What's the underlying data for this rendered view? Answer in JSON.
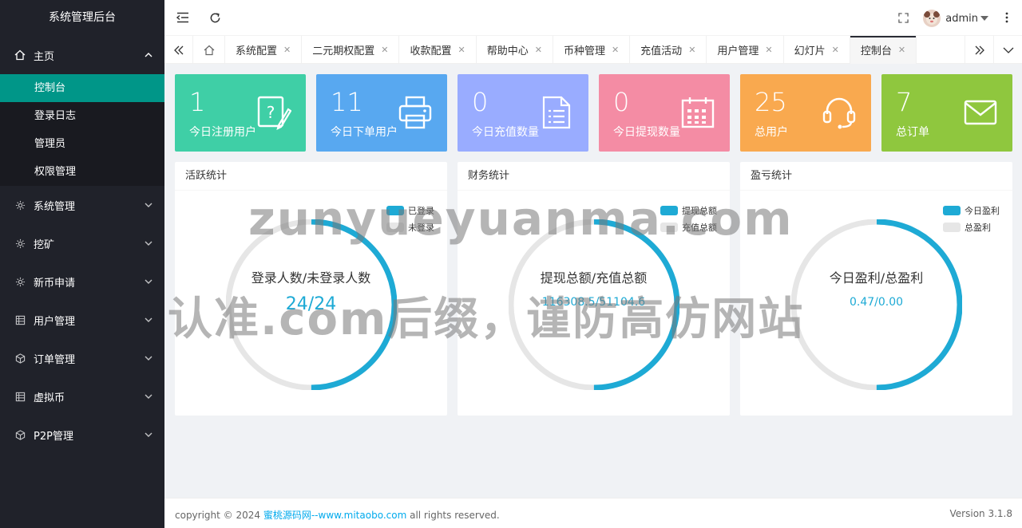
{
  "sidebar": {
    "title": "系统管理后台",
    "home": {
      "label": "主页",
      "icon": "home-icon"
    },
    "home_items": [
      {
        "label": "控制台",
        "active": true
      },
      {
        "label": "登录日志"
      },
      {
        "label": "管理员"
      },
      {
        "label": "权限管理"
      }
    ],
    "groups": [
      {
        "label": "系统管理",
        "icon": "gear-icon"
      },
      {
        "label": "挖矿",
        "icon": "gear-icon"
      },
      {
        "label": "新币申请",
        "icon": "gear-icon"
      },
      {
        "label": "用户管理",
        "icon": "table-icon"
      },
      {
        "label": "订单管理",
        "icon": "cube-icon"
      },
      {
        "label": "虚拟币",
        "icon": "table-icon"
      },
      {
        "label": "P2P管理",
        "icon": "cube-icon"
      }
    ]
  },
  "header": {
    "user": "admin"
  },
  "tabs": {
    "items": [
      "系统配置",
      "二元期权配置",
      "收款配置",
      "帮助中心",
      "币种管理",
      "充值活动",
      "用户管理",
      "幻灯片",
      "控制台"
    ],
    "active": "控制台"
  },
  "cards": [
    {
      "value": "1",
      "label": "今日注册用户",
      "color": "#3fcfa6",
      "icon": "question-note-icon"
    },
    {
      "value": "11",
      "label": "今日下单用户",
      "color": "#58a8f0",
      "icon": "printer-icon"
    },
    {
      "value": "0",
      "label": "今日充值数量",
      "color": "#99acff",
      "icon": "document-list-icon"
    },
    {
      "value": "0",
      "label": "今日提现数量",
      "color": "#f48ca4",
      "icon": "calendar-icon"
    },
    {
      "value": "25",
      "label": "总用户",
      "color": "#f9a94f",
      "icon": "headset-icon"
    },
    {
      "value": "7",
      "label": "总订单",
      "color": "#8fc73e",
      "icon": "mail-icon"
    }
  ],
  "panels": [
    {
      "title": "活跃统计",
      "legend": [
        "已登录",
        "未登录"
      ],
      "center_label": "登录人数/未登录人数",
      "center_value": "24/24",
      "fraction": 0.5
    },
    {
      "title": "财务统计",
      "legend": [
        "提现总额",
        "充值总额"
      ],
      "center_label": "提现总额/充值总额",
      "center_value": "116308.5/51104.6",
      "fraction": 0.5
    },
    {
      "title": "盈亏统计",
      "legend": [
        "今日盈利",
        "总盈利"
      ],
      "center_label": "今日盈利/总盈利",
      "center_value": "0.47/0.00",
      "fraction": 0.5
    }
  ],
  "colors": {
    "primary_series": "#1eaad5",
    "secondary_series": "#e6e6e6",
    "sidebar_active": "#009688"
  },
  "footer": {
    "copyright_prefix": "copyright © 2024 ",
    "link_text": "蜜桃源码网--www.mitaobo.com",
    "copyright_suffix": " all rights reserved.",
    "version": "Version 3.1.8"
  },
  "watermark": {
    "line1": "zunyueyuanma.com",
    "line2": "认准.com后缀，谨防高仿网站"
  }
}
